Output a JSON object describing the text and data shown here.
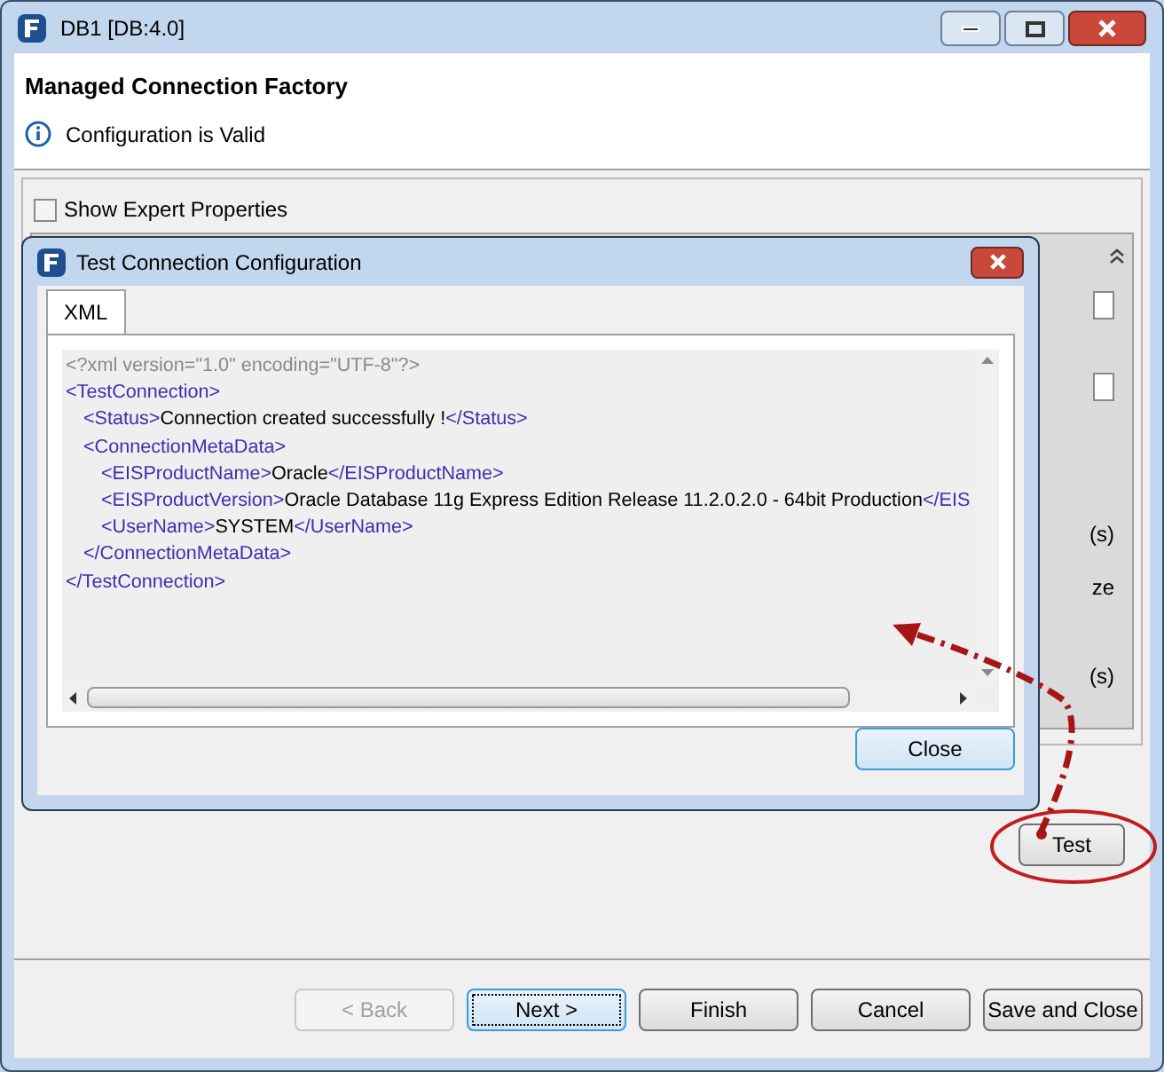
{
  "window": {
    "title": "DB1 [DB:4.0]"
  },
  "header": {
    "title": "Managed Connection Factory",
    "message": "Configuration is Valid"
  },
  "show_expert_properties": {
    "label": "Show Expert Properties",
    "checked": false
  },
  "background_fragments": [
    "(s)",
    "ze",
    "(s)"
  ],
  "dialog": {
    "title": "Test Connection Configuration",
    "tabs": [
      {
        "label": "XML",
        "selected": true
      }
    ],
    "xml_declaration": "<?xml version=\"1.0\" encoding=\"UTF-8\"?>",
    "xml_tree": [
      {
        "open": "<TestConnection>",
        "close": "</TestConnection>",
        "children": [
          {
            "parts": [
              {
                "kind": "tag",
                "text": "<Status>"
              },
              {
                "kind": "text",
                "text": "Connection created successfully !"
              },
              {
                "kind": "tag",
                "text": "</Status>"
              }
            ]
          },
          {
            "open": "<ConnectionMetaData>",
            "close": "</ConnectionMetaData>",
            "children": [
              {
                "parts": [
                  {
                    "kind": "tag",
                    "text": "<EISProductName>"
                  },
                  {
                    "kind": "text",
                    "text": "Oracle"
                  },
                  {
                    "kind": "tag",
                    "text": "</EISProductName>"
                  }
                ]
              },
              {
                "parts": [
                  {
                    "kind": "tag",
                    "text": "<EISProductVersion>"
                  },
                  {
                    "kind": "text",
                    "text": "Oracle Database 11g Express Edition Release 11.2.0.2.0 - 64bit Production"
                  },
                  {
                    "kind": "tag",
                    "text": "</EIS"
                  }
                ]
              },
              {
                "parts": [
                  {
                    "kind": "tag",
                    "text": "<UserName>"
                  },
                  {
                    "kind": "text",
                    "text": "SYSTEM"
                  },
                  {
                    "kind": "tag",
                    "text": "</UserName>"
                  }
                ]
              }
            ]
          }
        ]
      }
    ],
    "close_button": "Close"
  },
  "test_button": "Test",
  "buttons": [
    {
      "label": "< Back",
      "disabled": true,
      "focused": false
    },
    {
      "label": "Next >",
      "disabled": false,
      "focused": true
    },
    {
      "label": "Finish",
      "disabled": false,
      "focused": false
    },
    {
      "label": "Cancel",
      "disabled": false,
      "focused": false
    },
    {
      "label": "Save and Close",
      "disabled": false,
      "focused": false
    }
  ]
}
